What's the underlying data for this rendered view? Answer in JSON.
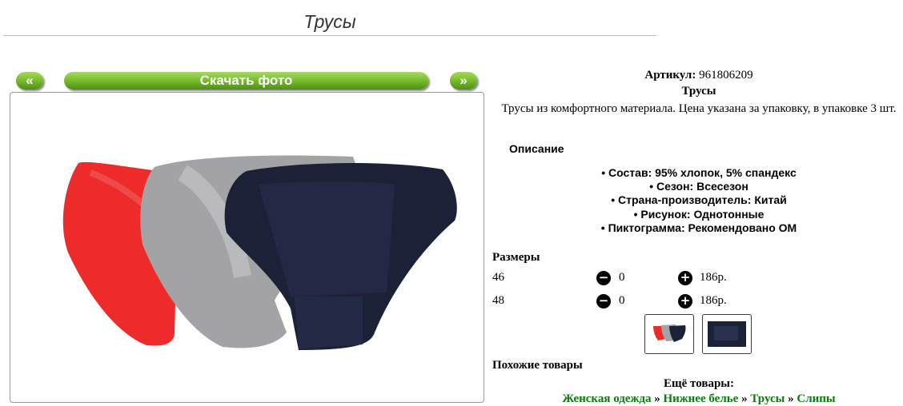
{
  "page": {
    "title": "Трусы"
  },
  "nav": {
    "prev_label": "«",
    "download_label": "Скачать фото",
    "next_label": "»"
  },
  "product": {
    "sku_label": "Артикул:",
    "sku": "961806209",
    "name": "Трусы",
    "description": "Трусы из комфортного материала. Цена указана за упаковку, в упаковке 3 шт.",
    "description_heading": "Описание",
    "attributes": [
      "Состав: 95% хлопок, 5% спандекс",
      "Сезон: Всесезон",
      "Страна-производитель: Китай",
      "Рисунок: Однотонные",
      "Пиктограмма: Рекомендовано ОМ"
    ],
    "product_colors": [
      "#ee2b2b",
      "#a3a3a5",
      "#1b2136"
    ]
  },
  "sizes": {
    "heading": "Размеры",
    "rows": [
      {
        "size": "46",
        "qty": "0",
        "price": "186р."
      },
      {
        "size": "48",
        "qty": "0",
        "price": "186р."
      }
    ],
    "minus_icon": "minus-circle-icon",
    "plus_icon": "plus-circle-icon"
  },
  "similar": {
    "heading": "Похожие товары",
    "more_heading": "Ещё товары:",
    "breadcrumbs": [
      "Женская одежда",
      "Нижнее белье",
      "Трусы",
      "Слипы"
    ],
    "separator": "»",
    "link_color": "#0a7d0a"
  },
  "accent": {
    "button_green": "#7bbf2e"
  }
}
